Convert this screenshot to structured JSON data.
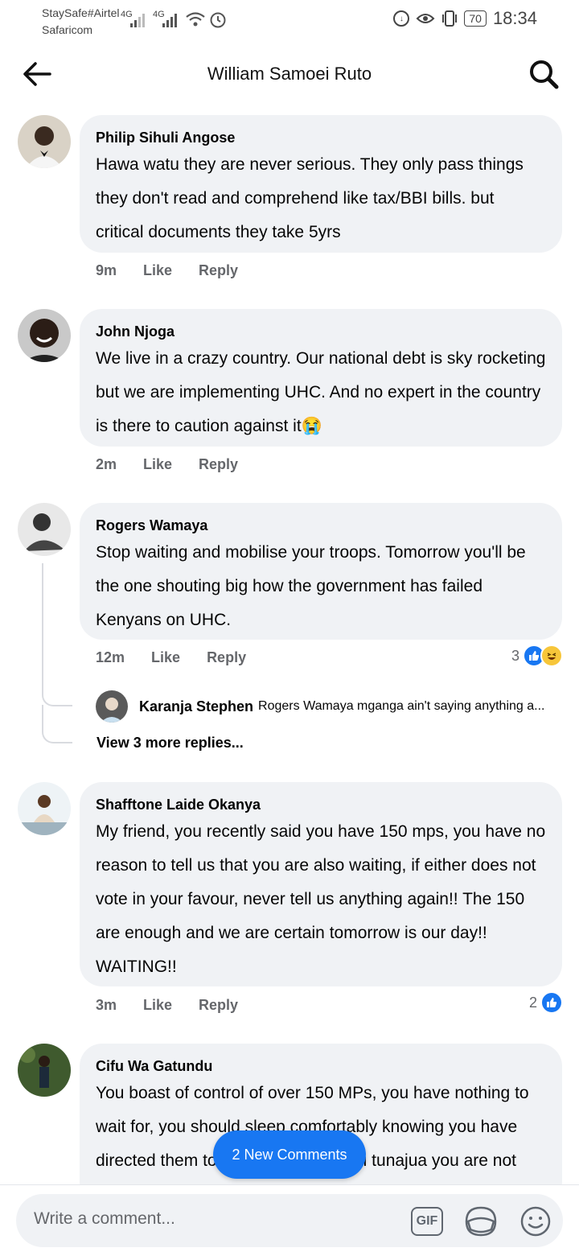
{
  "status_bar": {
    "carrier_line1": "StaySafe#Airtel",
    "carrier_line2": "Safaricom",
    "network1": "4G",
    "network2": "4G",
    "battery": "70",
    "time": "18:34"
  },
  "header": {
    "title": "William Samoei Ruto",
    "back_icon": "arrow-left-icon",
    "search_icon": "search-icon"
  },
  "comments": [
    {
      "author": "Philip Sihuli Angose",
      "text": "Hawa watu they are never serious. They only pass things they don't read and comprehend like tax/BBI bills. but critical documents they take 5yrs",
      "time": "9m",
      "like": "Like",
      "reply": "Reply"
    },
    {
      "author": "John Njoga",
      "text": "We live in a crazy country. Our national debt is sky rocketing but we are implementing UHC. And no expert in the country is there to caution against it😭",
      "time": "2m",
      "like": "Like",
      "reply": "Reply"
    },
    {
      "author": "Rogers Wamaya",
      "text": "Stop waiting and mobilise your troops. Tomorrow you'll be the one shouting big how the government has failed Kenyans on UHC.",
      "time": "12m",
      "like": "Like",
      "reply": "Reply",
      "reaction_count": "3",
      "reply_preview": {
        "author": "Karanja Stephen",
        "text": "Rogers Wamaya mganga ain't saying anything a..."
      },
      "more_replies": "View 3 more replies..."
    },
    {
      "author": "Shafftone Laide Okanya",
      "text": "My friend, you recently said you have 150 mps, you have no reason to tell us that you are also waiting, if either does not vote in your favour, never tell us anything again!! The 150 are enough and we are certain tomorrow is our day!! WAITING!!",
      "time": "3m",
      "like": "Like",
      "reply": "Reply",
      "reaction_count": "2"
    },
    {
      "author": "Cifu Wa Gatundu",
      "text": "You boast of control of over 150 MPs, you have nothing to wait for, you should sleep comfortably knowing you have directed them to vote. Sasa kwa nini tunajua you are not"
    }
  ],
  "new_comments_pill": "2 New Comments",
  "composer": {
    "placeholder": "Write a comment...",
    "gif_label": "GIF"
  },
  "colors": {
    "accent": "#1877f2",
    "bubble": "#f0f2f5",
    "muted": "#65676b"
  }
}
